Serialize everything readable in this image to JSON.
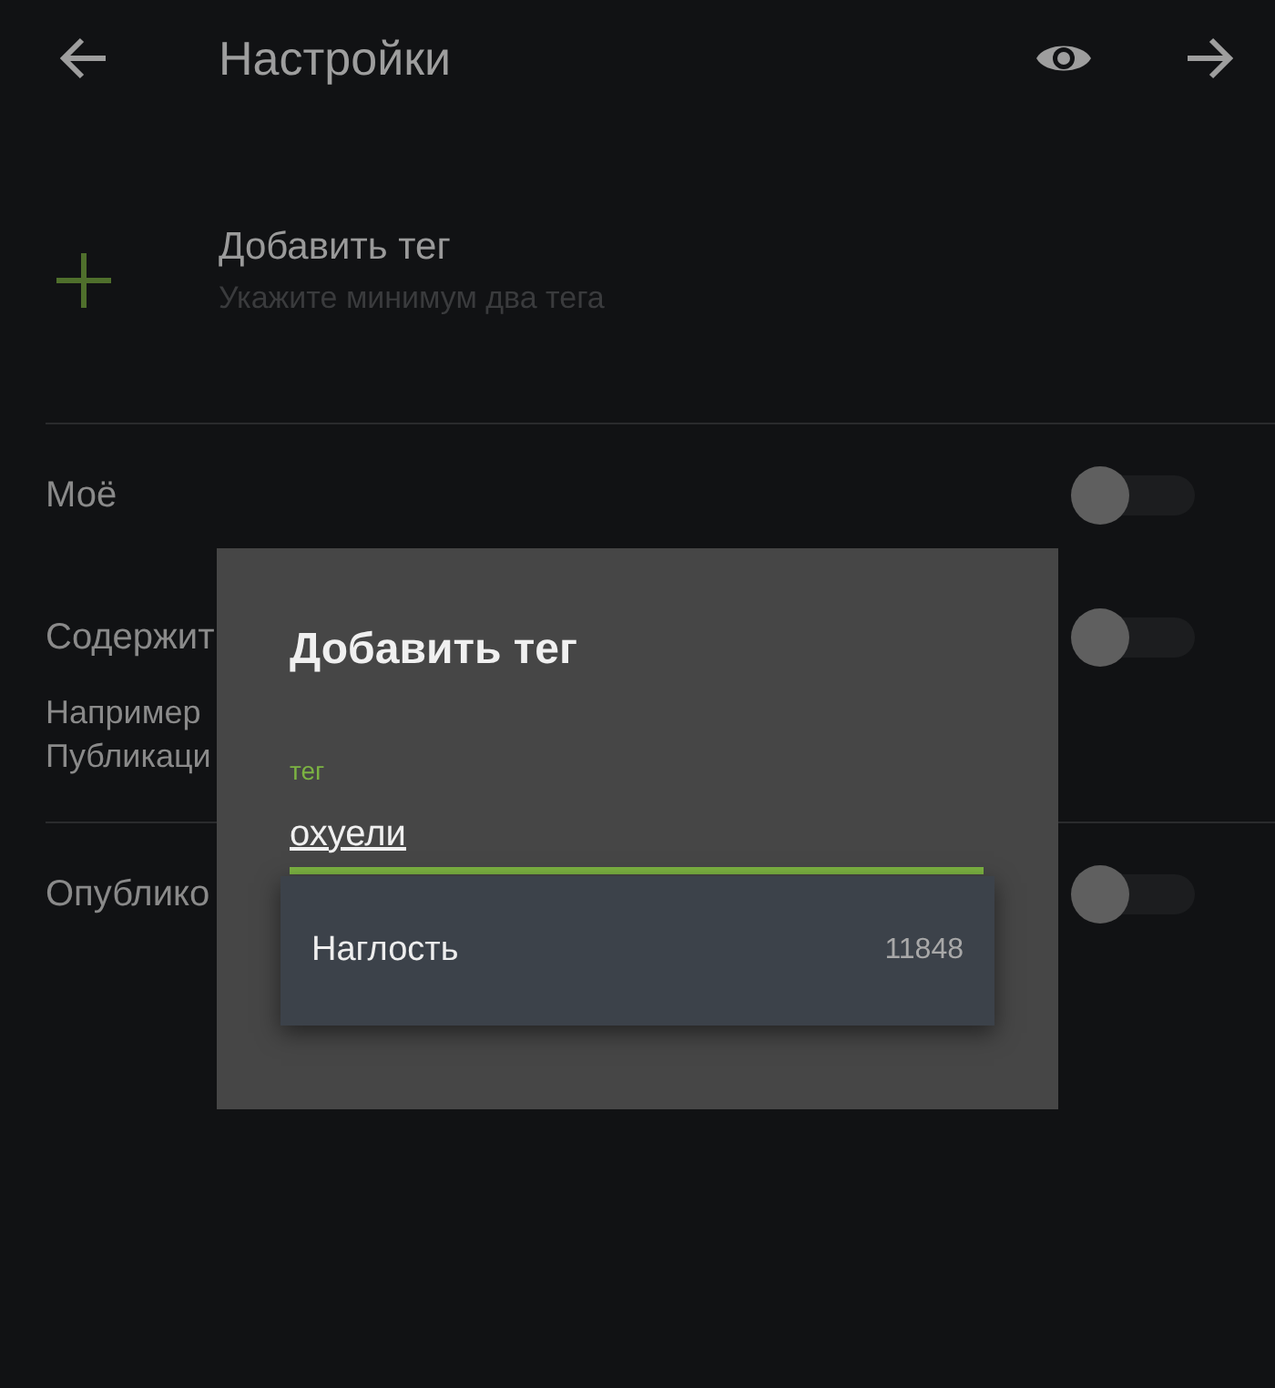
{
  "header": {
    "title": "Настройки"
  },
  "add_tag": {
    "title": "Добавить тег",
    "hint": "Укажите минимум два тега"
  },
  "settings": [
    {
      "kind": "switch",
      "label": "Моё",
      "on": false
    },
    {
      "kind": "switch",
      "label": "Содержит",
      "on": false,
      "description": [
        "Например",
        "Публикаци"
      ]
    },
    {
      "kind": "switch",
      "label": "Опублико",
      "on": false
    }
  ],
  "dialog": {
    "title": "Добавить тег",
    "field": {
      "label": "тег",
      "value": "охуели"
    },
    "suggestions": [
      {
        "name": "Наглость",
        "count": "11848"
      }
    ]
  }
}
